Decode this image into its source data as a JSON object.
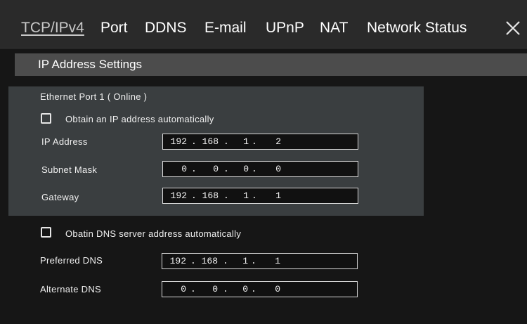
{
  "tabs": [
    {
      "label": "TCP/IPv4",
      "active": true
    },
    {
      "label": "Port"
    },
    {
      "label": "DDNS"
    },
    {
      "label": "E-mail"
    },
    {
      "label": "UPnP"
    },
    {
      "label": "NAT"
    },
    {
      "label": "Network Status"
    }
  ],
  "close_icon": "close-icon",
  "section": {
    "title": "IP Address Settings"
  },
  "ethernet": {
    "port_label": "Ethernet Port 1 ( Online )",
    "auto_ip_label": "Obtain an IP address automatically",
    "auto_ip_checked": false,
    "fields": [
      {
        "label": "IP Address",
        "octets": [
          "192",
          "168",
          "1",
          "2"
        ]
      },
      {
        "label": "Subnet Mask",
        "octets": [
          "0",
          "0",
          "0",
          "0"
        ]
      },
      {
        "label": "Gateway",
        "octets": [
          "192",
          "168",
          "1",
          "1"
        ]
      }
    ]
  },
  "dns": {
    "auto_dns_label": "Obatin DNS server address automatically",
    "auto_dns_checked": false,
    "fields": [
      {
        "label": "Preferred DNS",
        "octets": [
          "192",
          "168",
          "1",
          "1"
        ]
      },
      {
        "label": "Alternate DNS",
        "octets": [
          "0",
          "0",
          "0",
          "0"
        ]
      }
    ]
  },
  "colors": {
    "tabbar_bg": "#2a2a2a",
    "section_header_bg": "#4c4c4c",
    "panel_bg": "#3a3e40",
    "page_bg": "#161616"
  }
}
